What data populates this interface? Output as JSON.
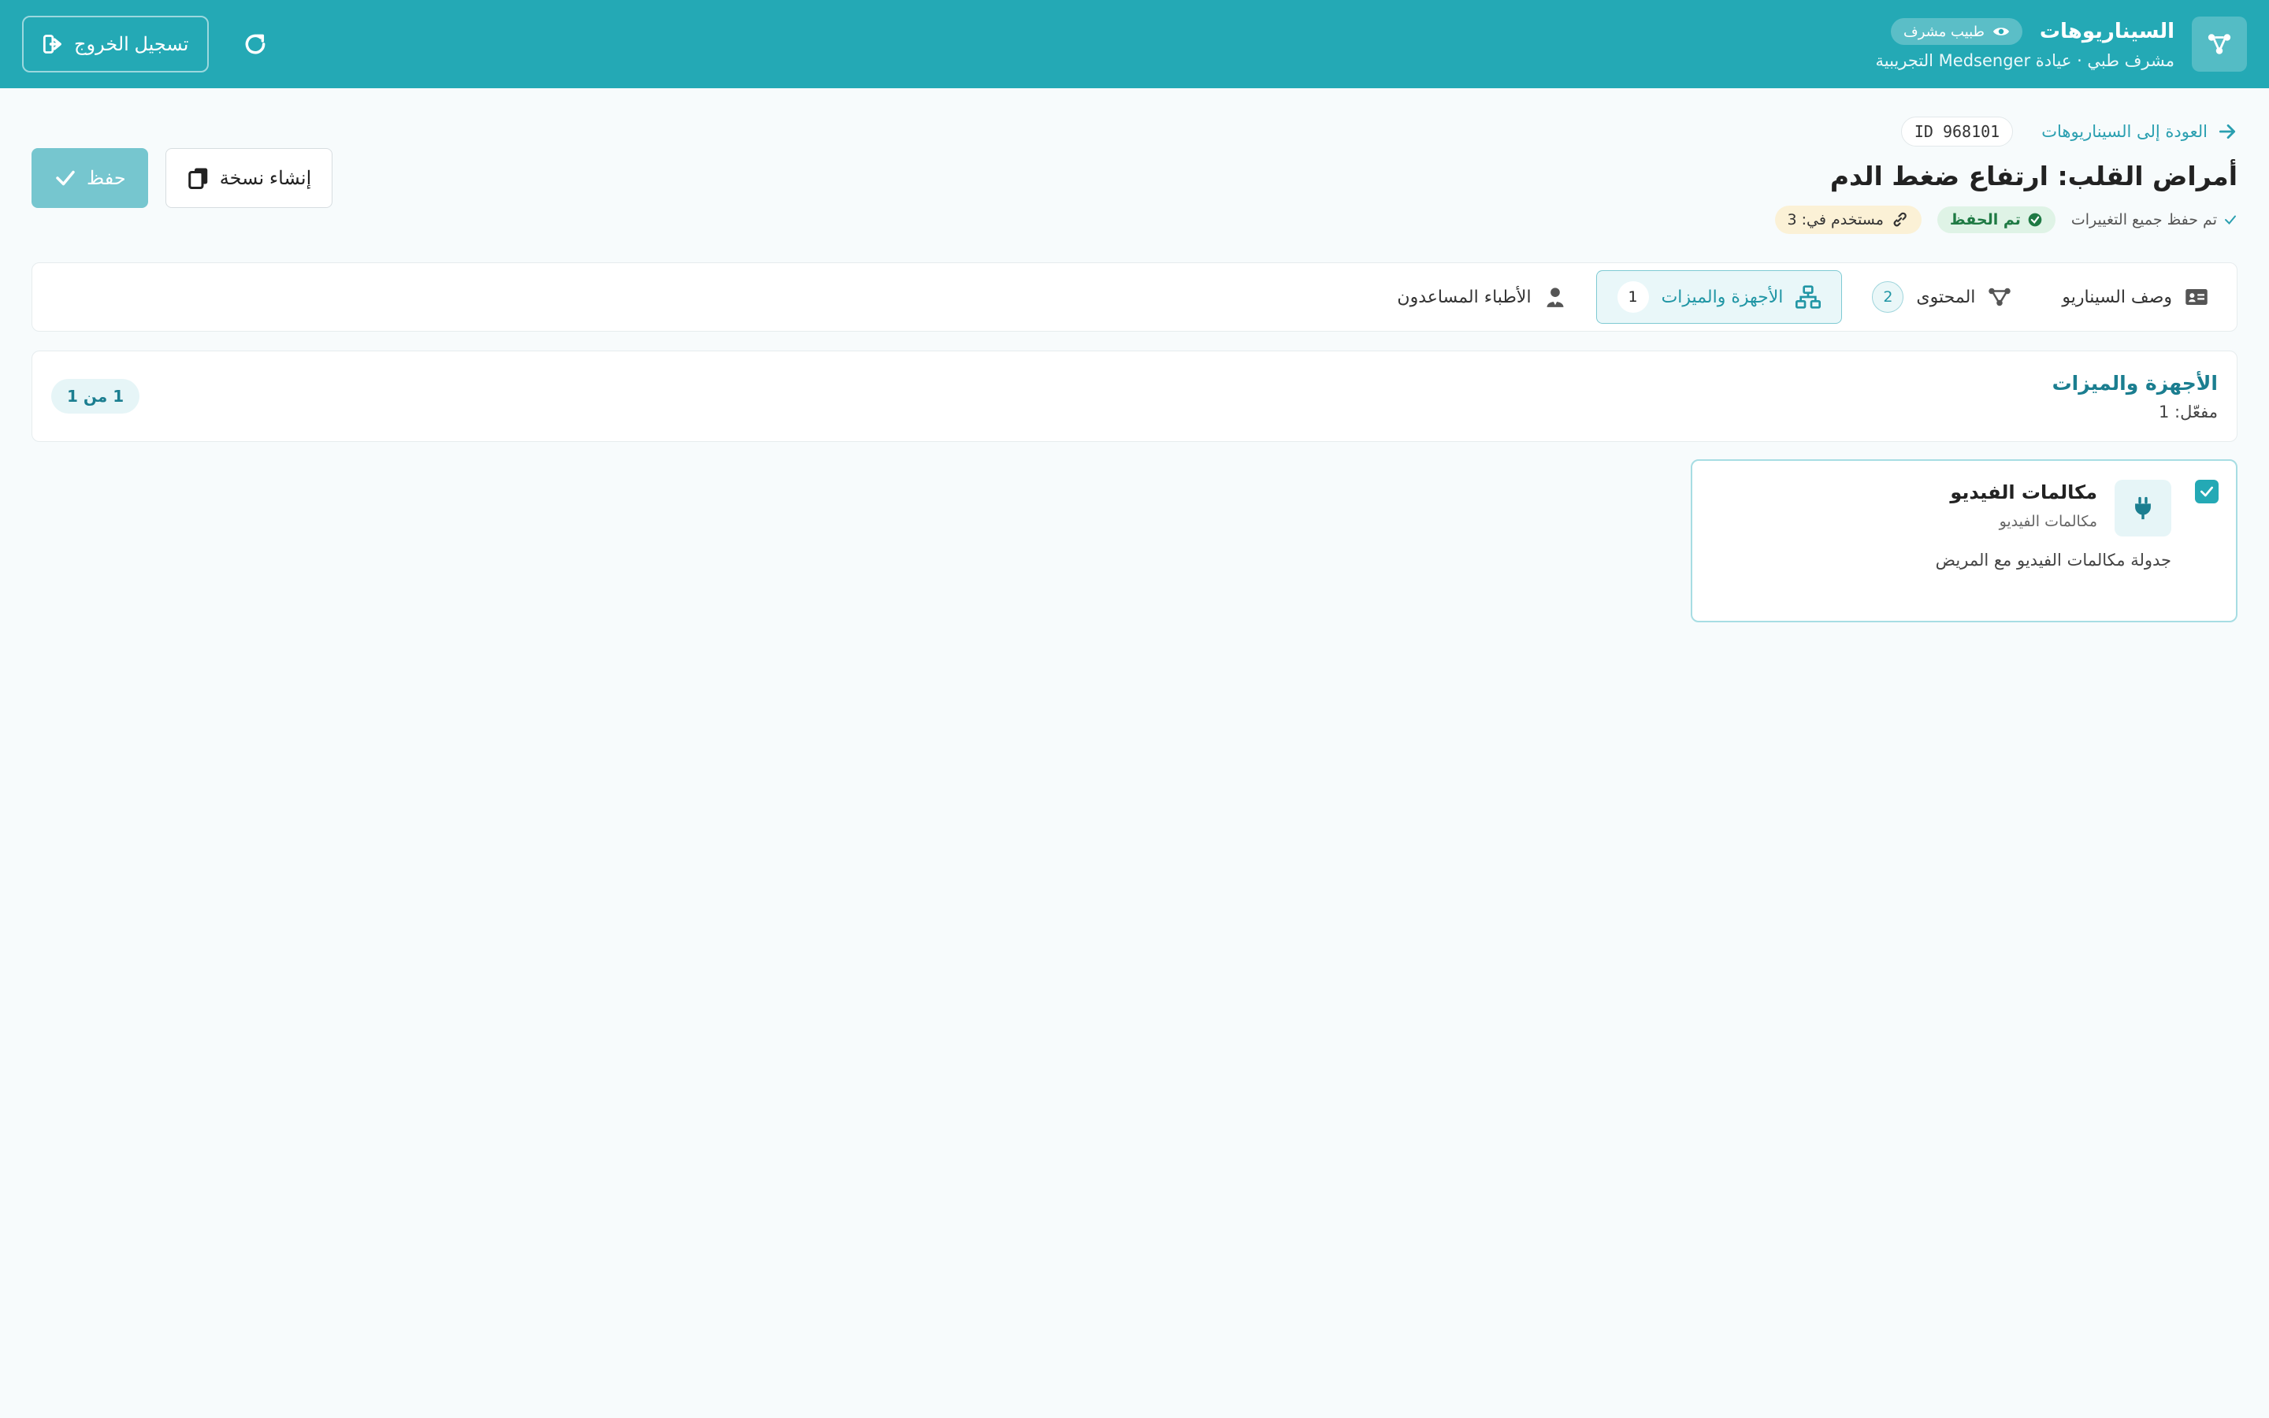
{
  "header": {
    "title": "السيناريوهات",
    "role": "طبيب مشرف",
    "subtitle": "مشرف طبي · عيادة Medsenger التجريبية",
    "logout_label": "تسجيل الخروج"
  },
  "page": {
    "back_label": "العودة إلى السيناريوهات",
    "id_label": "ID 968101",
    "title": "أمراض القلب: ارتفاع ضغط الدم",
    "saved_all": "تم حفظ جميع التغييرات",
    "saved_badge": "تم الحفظ",
    "used_in": "مستخدم في: 3",
    "save_label": "حفظ",
    "copy_label": "إنشاء نسخة"
  },
  "tabs": [
    {
      "label": "وصف السيناريو",
      "icon": "id-card-icon"
    },
    {
      "label": "المحتوى",
      "count": "2",
      "icon": "diagram-icon"
    },
    {
      "label": "الأجهزة والميزات",
      "count": "1",
      "icon": "network-icon"
    },
    {
      "label": "الأطباء المساعدون",
      "icon": "doctor-icon"
    }
  ],
  "section": {
    "title": "الأجهزة والميزات",
    "enabled": "مفعّل: 1",
    "page_count": "1 من 1"
  },
  "feature": {
    "title": "مكالمات الفيديو",
    "subtitle": "مكالمات الفيديو",
    "description": "جدولة مكالمات الفيديو مع المريض",
    "checked": true,
    "icon": "plug-icon"
  },
  "colors": {
    "primary": "#24a9b5",
    "accent_text": "#1b7e90",
    "success": "#1f7a44",
    "warning_bg": "#fbf1d6"
  }
}
